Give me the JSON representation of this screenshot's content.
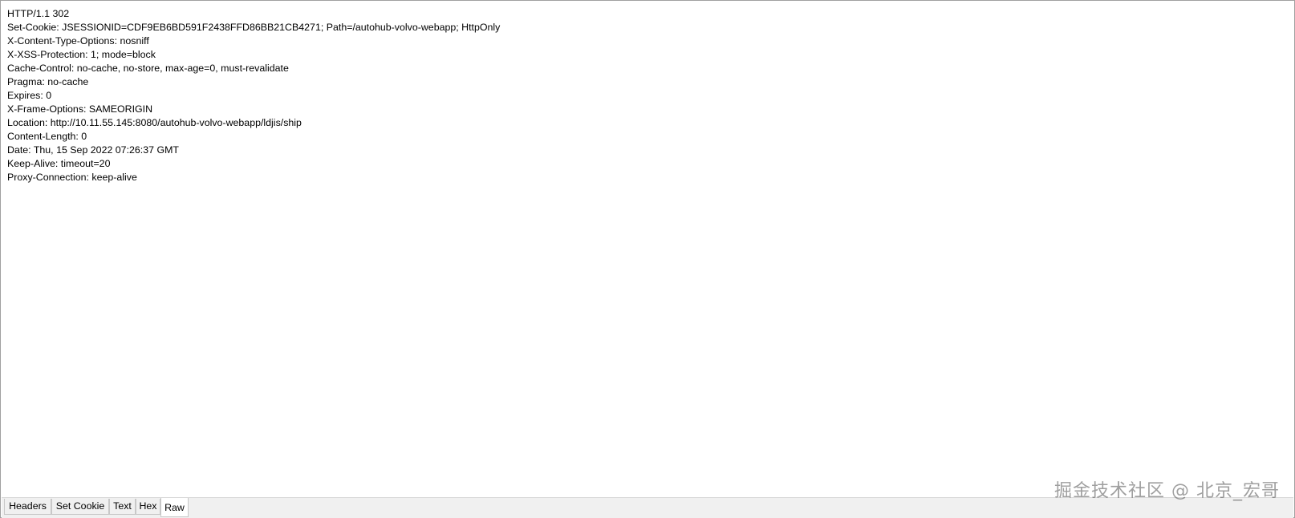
{
  "response_headers": [
    "HTTP/1.1 302",
    "Set-Cookie: JSESSIONID=CDF9EB6BD591F2438FFD86BB21CB4271; Path=/autohub-volvo-webapp; HttpOnly",
    "X-Content-Type-Options: nosniff",
    "X-XSS-Protection: 1; mode=block",
    "Cache-Control: no-cache, no-store, max-age=0, must-revalidate",
    "Pragma: no-cache",
    "Expires: 0",
    "X-Frame-Options: SAMEORIGIN",
    "Location: http://10.11.55.145:8080/autohub-volvo-webapp/ldjis/ship",
    "Content-Length: 0",
    "Date: Thu, 15 Sep 2022 07:26:37 GMT",
    "Keep-Alive: timeout=20",
    "Proxy-Connection: keep-alive"
  ],
  "tabs": [
    {
      "label": "Headers",
      "active": false
    },
    {
      "label": "Set Cookie",
      "active": false
    },
    {
      "label": "Text",
      "active": false
    },
    {
      "label": "Hex",
      "active": false
    },
    {
      "label": "Raw",
      "active": true
    }
  ],
  "watermark": "掘金技术社区 @ 北京_宏哥"
}
